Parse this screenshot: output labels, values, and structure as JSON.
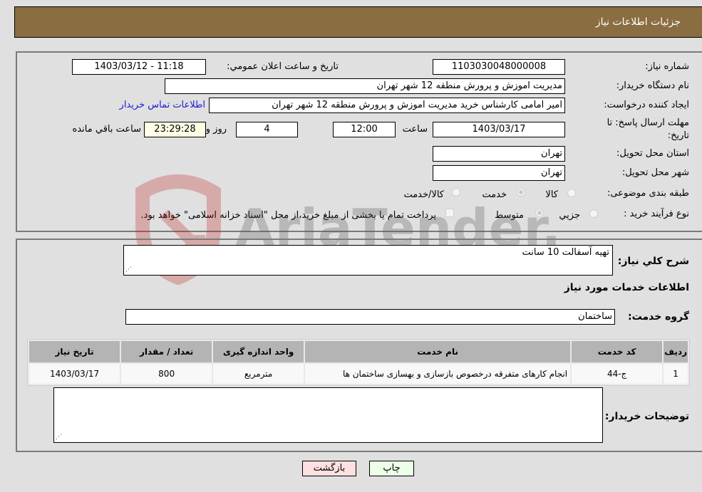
{
  "header": {
    "title": "جزئیات اطلاعات نیاز"
  },
  "form": {
    "need_number": {
      "label": "شماره نیاز:",
      "value": "1103030048000008"
    },
    "announce_datetime": {
      "label": "تاریخ و ساعت اعلان عمومي:",
      "value": "1403/03/12 - 11:18"
    },
    "buyer_org": {
      "label": "نام دستگاه خريدار:",
      "value": "مدیریت اموزش و پرورش منطقه 12 شهر تهران"
    },
    "requester": {
      "label": "ايجاد کننده درخواست:",
      "value": "امیر امامی کارشناس خرید مدیریت اموزش و پرورش منطقه 12 شهر تهران"
    },
    "contact_link": "اطلاعات تماس خريدار",
    "deadline": {
      "label_line1": "مهلت ارسال پاسخ: تا",
      "label_line2": "تاریخ:",
      "date": "1403/03/17",
      "time_label": "ساعت",
      "time": "12:00",
      "days": "4",
      "days_label": "روز و",
      "remaining": "23:29:28",
      "remaining_label": "ساعت باقي مانده"
    },
    "province": {
      "label": "استان محل تحويل:",
      "value": "تهران"
    },
    "city": {
      "label": "شهر محل تحويل:",
      "value": "تهران"
    },
    "category": {
      "label": "طبقه بندی موضوعی:",
      "options": [
        "کالا",
        "خدمت",
        "کالا/خدمت"
      ],
      "selected": "خدمت"
    },
    "process_type": {
      "label": "نوع فرآیند خرید :",
      "options": [
        "جزيي",
        "متوسط"
      ],
      "selected": "متوسط",
      "treasury_note": "پرداخت تمام يا بخشی از مبلغ خريد،از محل \"اسناد خزانه اسلامی\" خواهد بود."
    }
  },
  "details": {
    "summary_label": "شرح كلي نياز:",
    "summary_value": "تهیه آسفالت 10 سانت",
    "services_title": "اطلاعات خدمات مورد نياز",
    "service_group_label": "گروه خدمت:",
    "service_group_value": "ساختمان",
    "table": {
      "headers": [
        "رديف",
        "كد خدمت",
        "نام خدمت",
        "واحد اندازه گيری",
        "تعداد / مقدار",
        "تاريخ نياز"
      ],
      "rows": [
        [
          "1",
          "ج-44",
          "انجام کارهای متفرقه درخصوص بازسازی و بهسازی ساختمان ها",
          "مترمربع",
          "800",
          "1403/03/17"
        ]
      ]
    },
    "buyer_notes_label": "توضيحات خريدار:",
    "buyer_notes_value": ""
  },
  "buttons": {
    "print": "چاپ",
    "back": "بازگشت"
  },
  "watermark": {
    "text": "AriaTender.neT"
  }
}
